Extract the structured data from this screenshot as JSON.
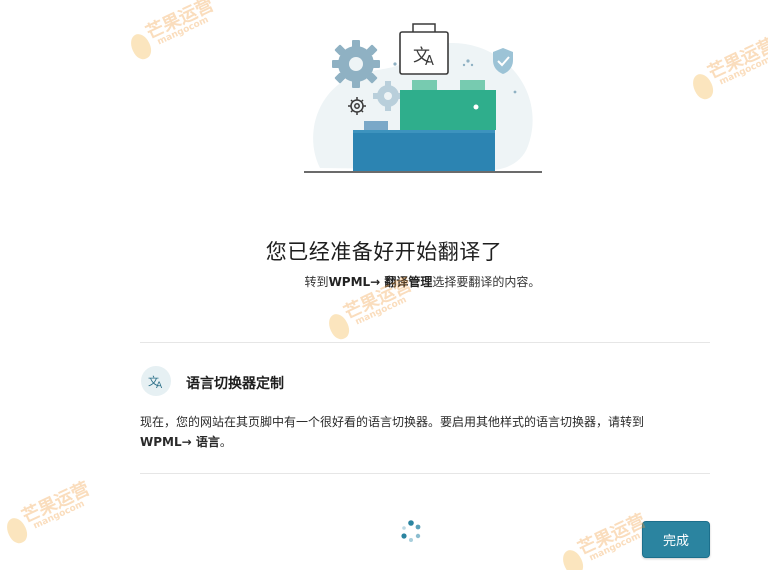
{
  "main": {
    "heading": "您已经准备好开始翻译了",
    "subtitle": {
      "prefix": "转到",
      "path": "WPML→ 翻译管理",
      "suffix": "选择要翻译的内容。"
    }
  },
  "section": {
    "icon": "translate-icon",
    "title": "语言切换器定制",
    "description_line1": "现在，您的网站在其页脚中有一个很好看的语言切换器。要启用其他样式的语言切换器，请转到",
    "description_line2_bold": "WPML→ 语言",
    "description_line2_suffix": "。"
  },
  "footer": {
    "done_label": "完成"
  },
  "watermark": {
    "main_text": "芒果运营",
    "sub_text": "mangocom"
  },
  "colors": {
    "primary_button": "#2b84a0",
    "green_block": "#2fae8c",
    "blue_block": "#2c84b2",
    "watermark": "#f29a3a"
  }
}
